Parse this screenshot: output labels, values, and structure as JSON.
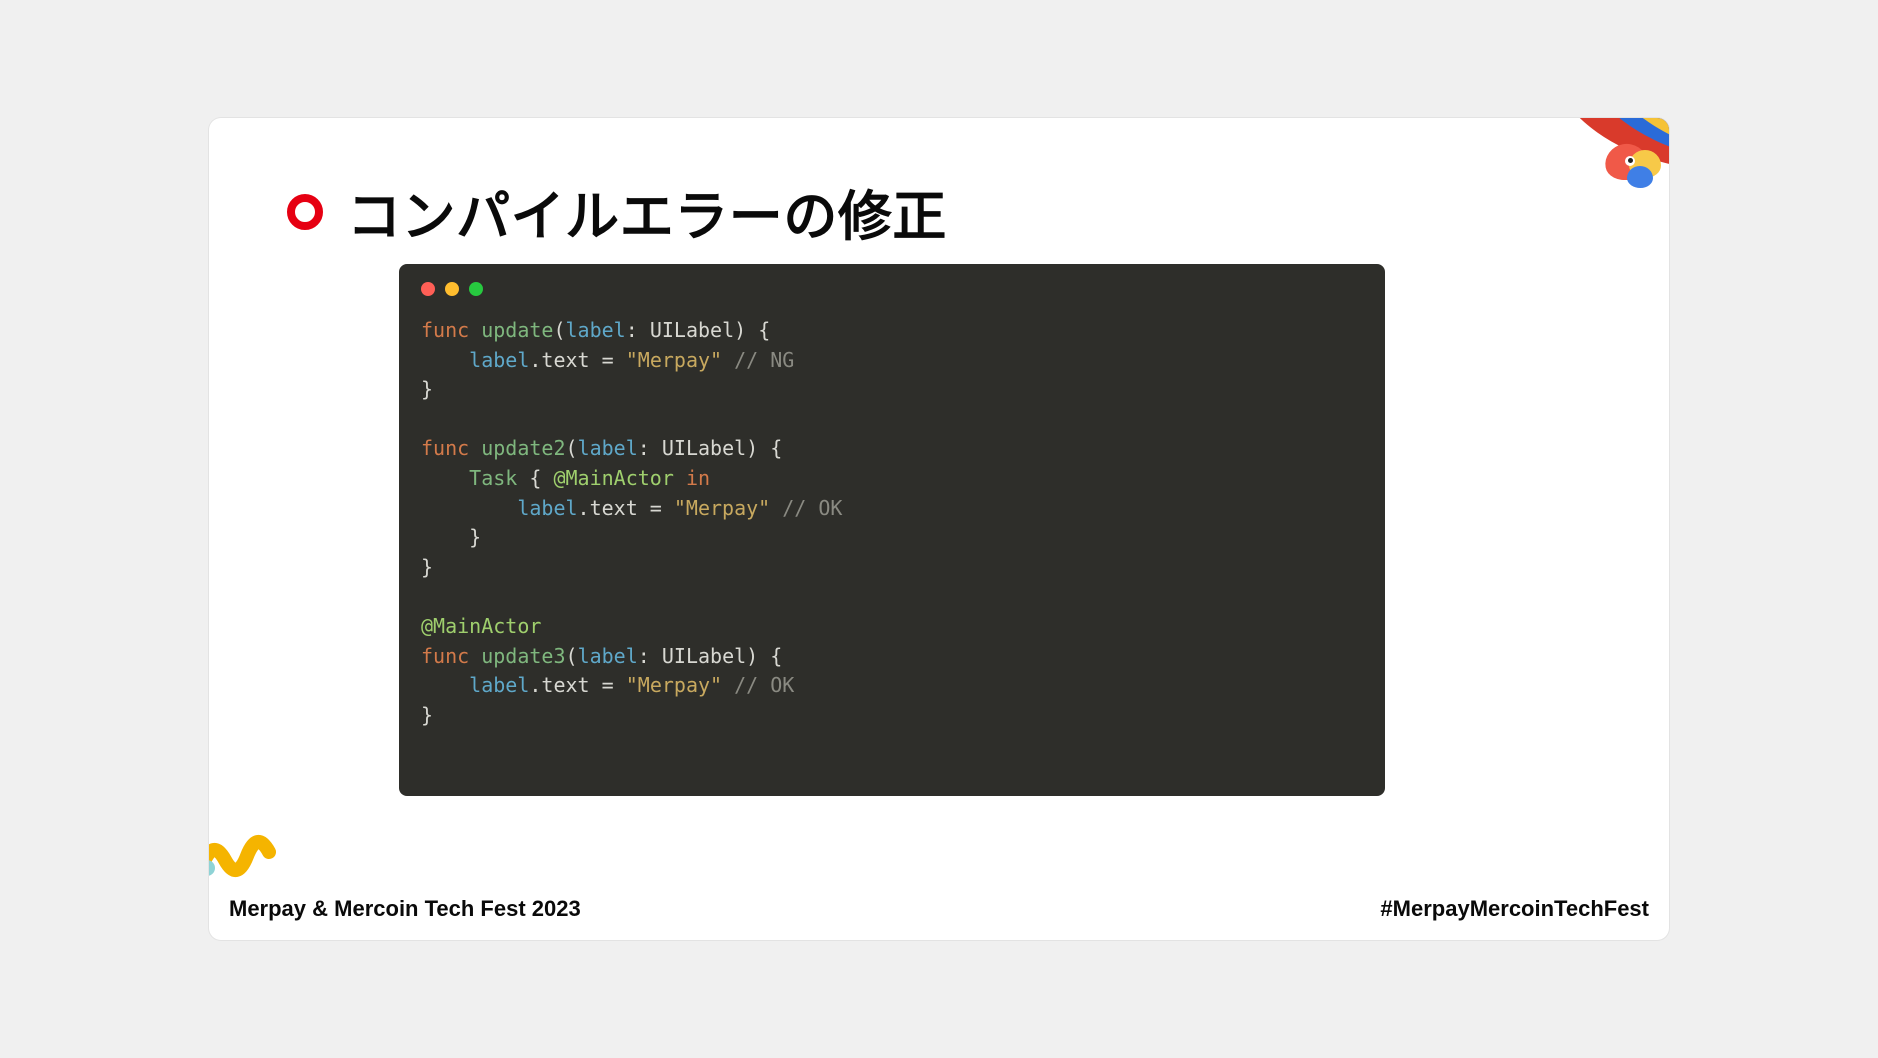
{
  "title": "コンパイルエラーの修正",
  "code": {
    "fn1_kw": "func",
    "fn1_name": "update",
    "fn1_param": "label",
    "fn1_type": "UILabel",
    "fn1_body_var": "label",
    "fn1_body_prop": ".text",
    "fn1_body_eq": " = ",
    "fn1_body_str": "\"Merpay\"",
    "fn1_body_cmt": " // NG",
    "fn2_kw": "func",
    "fn2_name": "update2",
    "fn2_param": "label",
    "fn2_type": "UILabel",
    "fn2_task": "Task",
    "fn2_attr": "@MainActor",
    "fn2_in": "in",
    "fn2_body_var": "label",
    "fn2_body_prop": ".text",
    "fn2_body_eq": " = ",
    "fn2_body_str": "\"Merpay\"",
    "fn2_body_cmt": " // OK",
    "fn3_attr": "@MainActor",
    "fn3_kw": "func",
    "fn3_name": "update3",
    "fn3_param": "label",
    "fn3_type": "UILabel",
    "fn3_body_var": "label",
    "fn3_body_prop": ".text",
    "fn3_body_eq": " = ",
    "fn3_body_str": "\"Merpay\"",
    "fn3_body_cmt": " // OK"
  },
  "footer": {
    "left": "Merpay & Mercoin Tech Fest 2023",
    "right": "#MerpayMercoinTechFest"
  }
}
